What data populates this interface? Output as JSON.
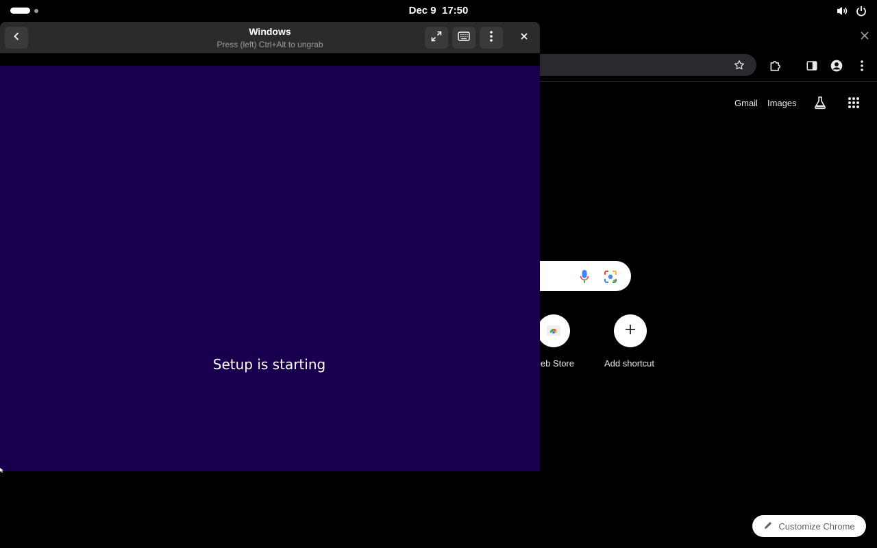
{
  "topbar": {
    "date": "Dec 9",
    "time": "17:50",
    "icons": [
      "activities-pill",
      "volume-icon",
      "power-icon"
    ]
  },
  "vm_window": {
    "title": "Windows",
    "subtitle": "Press (left) Ctrl+Alt to ungrab",
    "screen_bg": "#18004e",
    "screen_text": "Setup is starting",
    "buttons": [
      "back-icon",
      "fullscreen-icon",
      "keyboard-icon",
      "menu-icon",
      "close-icon"
    ]
  },
  "chrome": {
    "links": {
      "gmail": "Gmail",
      "images": "Images"
    },
    "shortcuts": [
      {
        "label": "Web Store",
        "visible_label": "eb Store",
        "icon": "chrome-webstore-icon"
      },
      {
        "label": "Add shortcut",
        "icon": "plus-icon"
      }
    ],
    "customize_label": "Customize Chrome",
    "accent": "#ffffff"
  }
}
